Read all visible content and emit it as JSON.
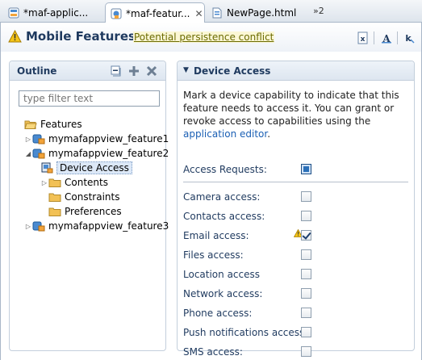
{
  "tabs": [
    {
      "label": "*maf-applic...",
      "icon": "maf-application-icon",
      "active": false
    },
    {
      "label": "*maf-featur...",
      "icon": "maf-feature-icon",
      "active": true,
      "close": "✕"
    },
    {
      "label": "NewPage.html",
      "icon": "html-page-icon",
      "active": false
    }
  ],
  "tab_overflow": "»2",
  "editor": {
    "title": "Mobile Features",
    "warning_link": "Potential persistence conflict",
    "toolbar_icons": [
      "source-view-icon",
      "font-icon",
      "help-icon"
    ]
  },
  "outline": {
    "title": "Outline",
    "toolbar_icons": [
      "collapse-all-icon",
      "add-icon",
      "delete-icon"
    ],
    "filter_placeholder": "type filter text",
    "tree": [
      {
        "label": "Features",
        "icon": "folder-open-icon",
        "expanded": true
      },
      {
        "label": "mymafappview_feature1",
        "icon": "feature-icon",
        "expanded": false
      },
      {
        "label": "mymafappview_feature2",
        "icon": "feature-icon",
        "expanded": true
      },
      {
        "label": "Device Access",
        "icon": "device-access-icon",
        "selected": true
      },
      {
        "label": "Contents",
        "icon": "folder-icon",
        "expanded": false
      },
      {
        "label": "Constraints",
        "icon": "folder-icon"
      },
      {
        "label": "Preferences",
        "icon": "folder-icon"
      },
      {
        "label": "mymafappview_feature3",
        "icon": "feature-icon",
        "expanded": false
      }
    ]
  },
  "device_access": {
    "title": "Device Access",
    "description": "Mark a device capability to indicate that this feature needs to access it. You can grant or revoke access to capabilities using the ",
    "description_link": "application editor",
    "description_end": ".",
    "access_requests_label": "Access Requests:",
    "access_requests_checked": true,
    "capabilities": [
      {
        "label": "Camera access:",
        "checked": false,
        "warning": false
      },
      {
        "label": "Contacts access:",
        "checked": false,
        "warning": false
      },
      {
        "label": "Email access:",
        "checked": true,
        "warning": true
      },
      {
        "label": "Files access:",
        "checked": false,
        "warning": false
      },
      {
        "label": "Location access",
        "checked": false,
        "warning": false
      },
      {
        "label": "Network access:",
        "checked": false,
        "warning": false
      },
      {
        "label": "Phone access:",
        "checked": false,
        "warning": false
      },
      {
        "label": "Push notifications access:",
        "checked": false,
        "warning": false
      },
      {
        "label": "SMS access:",
        "checked": false,
        "warning": false
      }
    ]
  },
  "colors": {
    "accent": "#1f3a5f",
    "link": "#1a5fb4",
    "selection": "#dce8f7"
  }
}
